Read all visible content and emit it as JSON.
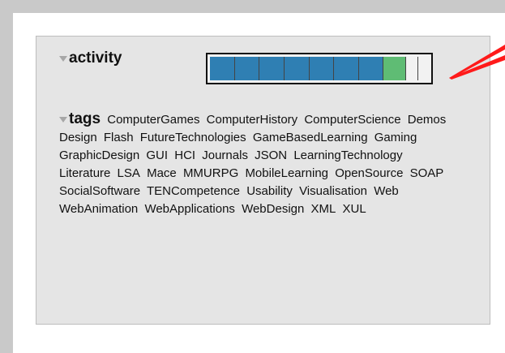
{
  "colors": {
    "frame": "#c9c9c9",
    "panel": "#e5e5e5",
    "panel_border": "#bdbdbd",
    "blue_segment": "#2f7fb3",
    "green_segment": "#5fbc74",
    "empty_segment": "#f2f2f2",
    "callout": "#ff1a1a"
  },
  "activity": {
    "title": "activity",
    "segments_filled": 7,
    "segments_highlighted": 1,
    "segments_total": 10
  },
  "tags": {
    "title": "tags",
    "items": [
      "ComputerGames",
      "ComputerHistory",
      "ComputerScience",
      "Demos",
      "Design",
      "Flash",
      "FutureTechnologies",
      "GameBasedLearning",
      "Gaming",
      "GraphicDesign",
      "GUI",
      "HCI",
      "Journals",
      "JSON",
      "LearningTechnology",
      "Literature",
      "LSA",
      "Mace",
      "MMURPG",
      "MobileLearning",
      "OpenSource",
      "SOAP",
      "SocialSoftware",
      "TENCompetence",
      "Usability",
      "Visualisation",
      "Web",
      "WebAnimation",
      "WebApplications",
      "WebDesign",
      "XML",
      "XUL"
    ]
  }
}
